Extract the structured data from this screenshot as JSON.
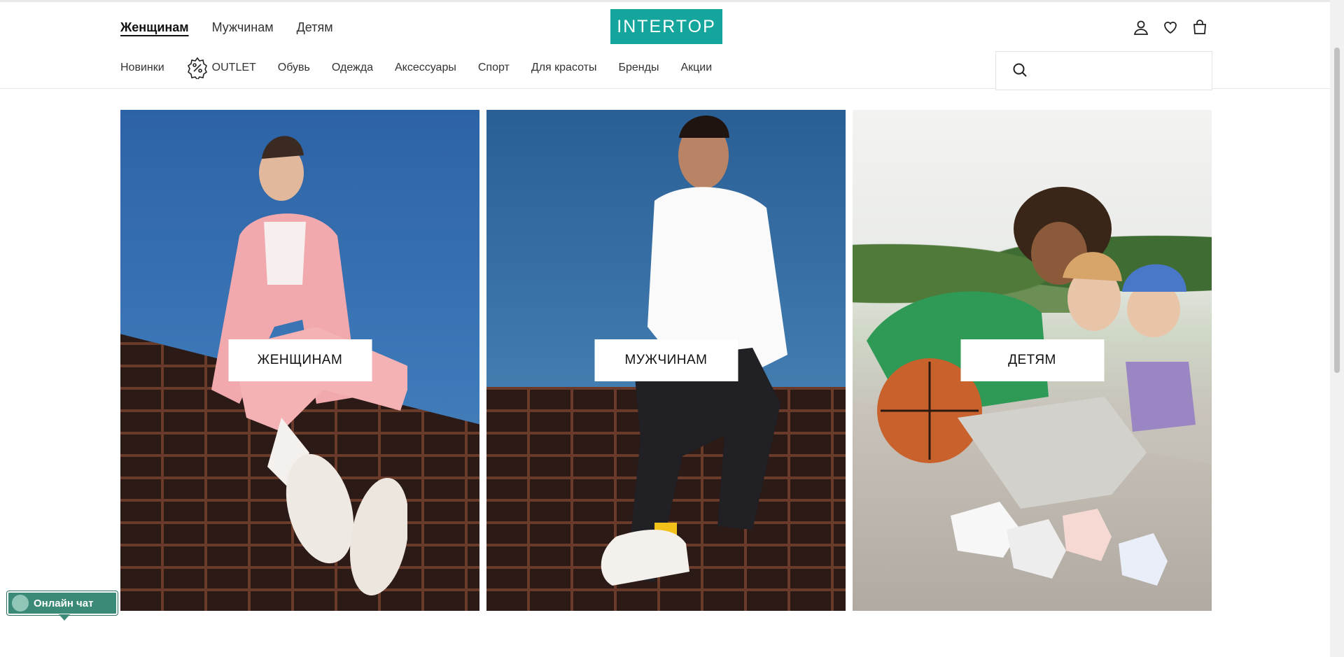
{
  "header": {
    "gender_nav": [
      {
        "label": "Женщинам",
        "active": true
      },
      {
        "label": "Мужчинам",
        "active": false
      },
      {
        "label": "Детям",
        "active": false
      }
    ],
    "logo_text": "INTERTOP",
    "logo_color": "#14a69d",
    "user_icons": [
      "account-icon",
      "heart-icon",
      "bag-icon"
    ]
  },
  "category_nav": {
    "items": [
      "Новинки",
      "OUTLET",
      "Обувь",
      "Одежда",
      "Аксессуары",
      "Спорт",
      "Для красоты",
      "Бренды",
      "Акции"
    ],
    "outlet_icon": "percent-badge-icon"
  },
  "search": {
    "placeholder": "",
    "icon": "search-icon"
  },
  "banners": [
    {
      "label": "ЖЕНЩИНАМ",
      "image": "woman in pink suit sitting on brick wall"
    },
    {
      "label": "МУЖЧИНАМ",
      "image": "man in white shirt sitting on brick wall"
    },
    {
      "label": "ДЕТЯМ",
      "image": "three children with basketball sitting on ramp"
    }
  ],
  "chat": {
    "label": "Онлайн чат",
    "color": "#3b8a78"
  }
}
